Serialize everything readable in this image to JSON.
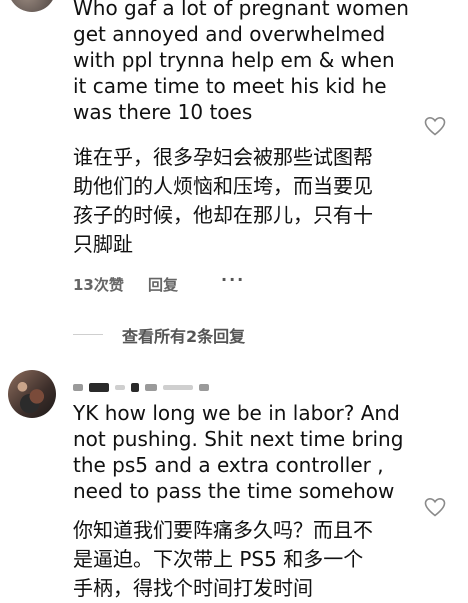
{
  "comment1": {
    "text_en_lines": [
      "Who gaf a lot of pregnant women",
      "get annoyed and overwhelmed",
      "with ppl trynna help em & when",
      "it came time to meet his kid he",
      "was there 10 toes"
    ],
    "translation_lines": [
      "谁在乎，很多孕妇会被那些试图帮",
      "助他们的人烦恼和压垮，而当要见",
      "孩子的时候，他却在那儿，只有十",
      "只脚趾"
    ],
    "likes": "13次赞",
    "reply": "回复",
    "more": "···"
  },
  "replies_toggle": "查看所有2条回复",
  "comment2": {
    "text_en_lines": [
      "YK how long we be in labor? And",
      "not pushing. Shit next time bring",
      "the ps5 and a extra controller ,",
      "need to pass the time somehow"
    ],
    "translation_lines": [
      "你知道我们要阵痛多久吗？而且不",
      "是逼迫。下次带上 PS5 和多一个",
      "手柄，得找个时间打发时间"
    ]
  },
  "icons": {
    "like": "heart-outline-icon",
    "more": "ellipsis-icon"
  }
}
